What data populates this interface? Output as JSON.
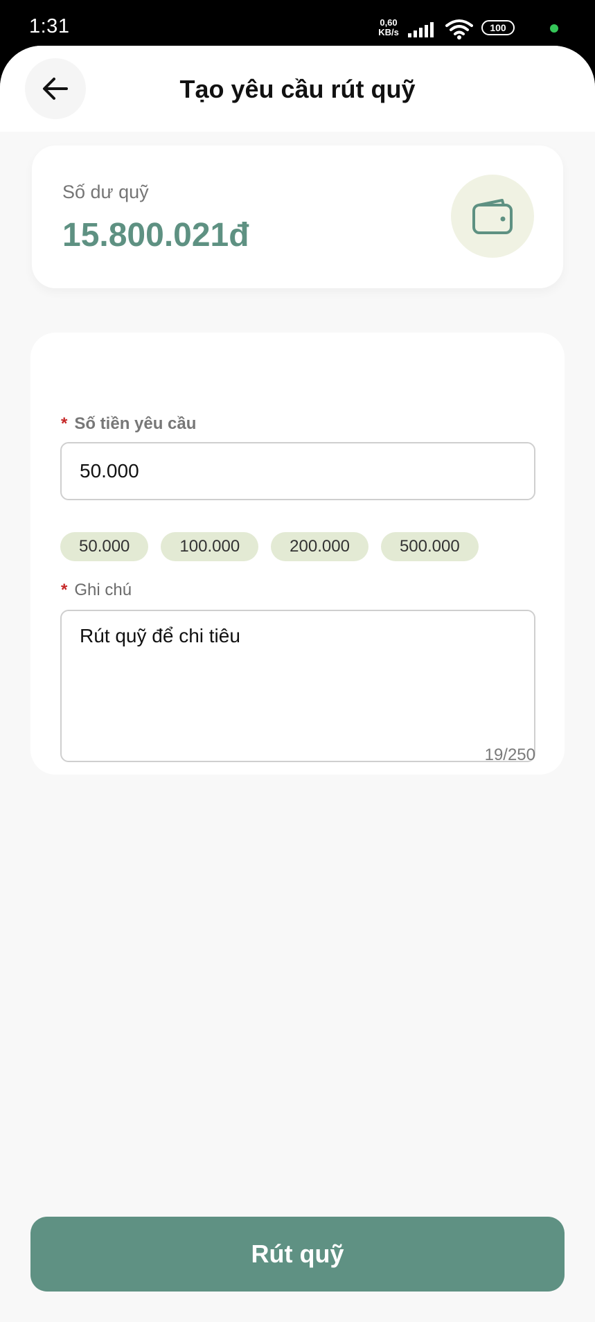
{
  "status_bar": {
    "time": "1:31",
    "net_speed_value": "0,60",
    "net_speed_unit": "KB/s",
    "battery": "100",
    "dot_color": "#35c659"
  },
  "header": {
    "title": "Tạo yêu cầu rút quỹ",
    "back_icon": "arrow-left-icon"
  },
  "balance": {
    "label": "Số dư quỹ",
    "amount": "15.800.021đ",
    "icon": "wallet-icon",
    "accent_color": "#5e9182"
  },
  "form": {
    "amount_field": {
      "required_mark": "*",
      "label": "Số tiền yêu cầu",
      "value": "50.000"
    },
    "quick_amounts": [
      "50.000",
      "100.000",
      "200.000",
      "500.000"
    ],
    "note_field": {
      "required_mark": "*",
      "label": "Ghi chú",
      "value": "Rút quỹ để chi tiêu",
      "counter": "19/250"
    }
  },
  "submit": {
    "label": "Rút quỹ",
    "color": "#5f9183"
  }
}
